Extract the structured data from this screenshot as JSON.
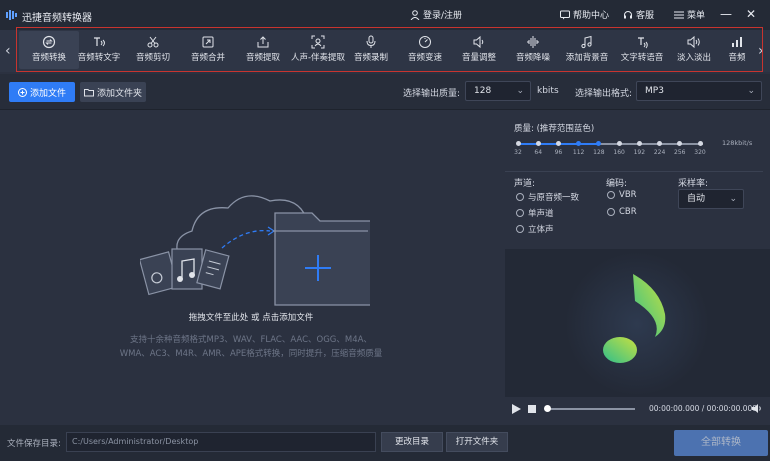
{
  "app": {
    "title": "迅捷音频转换器",
    "login_label": "登录/注册",
    "help_label": "帮助中心",
    "service_label": "客服",
    "menu_label": "菜单"
  },
  "toolbar": {
    "items": [
      {
        "label": "音频转换",
        "icon": "convert-icon"
      },
      {
        "label": "音频转文字",
        "icon": "audio-to-text-icon"
      },
      {
        "label": "音频剪切",
        "icon": "scissors-icon"
      },
      {
        "label": "音频合并",
        "icon": "merge-icon"
      },
      {
        "label": "音频提取",
        "icon": "extract-icon"
      },
      {
        "label": "人声-伴奏提取",
        "icon": "vocal-separate-icon"
      },
      {
        "label": "音频录制",
        "icon": "microphone-icon"
      },
      {
        "label": "音频变速",
        "icon": "speed-icon"
      },
      {
        "label": "音量调整",
        "icon": "volume-icon"
      },
      {
        "label": "音频降噪",
        "icon": "denoise-icon"
      },
      {
        "label": "添加背景音",
        "icon": "background-music-icon"
      },
      {
        "label": "文字转语音",
        "icon": "text-to-speech-icon"
      },
      {
        "label": "淡入淡出",
        "icon": "fade-icon"
      },
      {
        "label": "音频",
        "icon": "bars-icon"
      }
    ],
    "active_index": 0
  },
  "actions": {
    "add_file": "添加文件",
    "add_folder": "添加文件夹",
    "quality_label": "选择输出质量:",
    "quality_value": "128",
    "quality_unit": "kbits",
    "format_label": "选择输出格式:",
    "format_value": "MP3"
  },
  "drop": {
    "hint": "拖拽文件至此处 或 点击添加文件",
    "formats_line1": "支持十余种音频格式MP3、WAV、FLAC、AAC、OGG、M4A、",
    "formats_line2": "WMA、AC3、M4R、AMR、APE格式转换，同时提升，压缩音频质量"
  },
  "settings": {
    "quality_title": "质量: (推荐范围蓝色)",
    "quality_ticks": [
      "32",
      "64",
      "96",
      "112",
      "128",
      "160",
      "192",
      "224",
      "256",
      "320"
    ],
    "quality_unit_label": "128kbit/s",
    "channel_title": "声道:",
    "channel_options": [
      "与原音频一致",
      "单声道",
      "立体声"
    ],
    "encoding_title": "编码:",
    "encoding_options": [
      "VBR",
      "CBR"
    ],
    "samplerate_title": "采样率:",
    "samplerate_value": "自动"
  },
  "player": {
    "time": "00:00:00.000 / 00:00:00.000"
  },
  "bottom": {
    "save_label": "文件保存目录:",
    "save_path": "C:/Users/Administrator/Desktop",
    "change_dir": "更改目录",
    "open_folder": "打开文件夹",
    "convert_all": "全部转换"
  },
  "colors": {
    "accent": "#2f7cf6",
    "frame_red": "#c8342f",
    "note_green": "#a8d84a"
  }
}
